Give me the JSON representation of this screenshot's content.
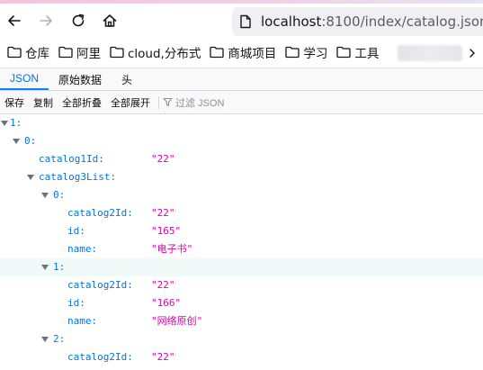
{
  "browser": {
    "url_host": "localhost",
    "url_rest": ":8100/index/catalog.json",
    "bookmarks": [
      {
        "label": "仓库"
      },
      {
        "label": "阿里"
      },
      {
        "label": "cloud,分布式"
      },
      {
        "label": "商城项目"
      },
      {
        "label": "学习"
      },
      {
        "label": "工具"
      }
    ]
  },
  "viewer": {
    "tabs": [
      "JSON",
      "原始数据",
      "头"
    ],
    "toolbar": {
      "save": "保存",
      "copy": "复制",
      "collapse_all": "全部折叠",
      "expand_all": "全部展开",
      "filter_placeholder": "过滤 JSON"
    }
  },
  "tree": [
    {
      "key": "1:",
      "value": null
    },
    {
      "key": "0:",
      "value": null
    },
    {
      "key": "catalog1Id:",
      "value": "\"22\""
    },
    {
      "key": "catalog3List:",
      "value": null
    },
    {
      "key": "0:",
      "value": null
    },
    {
      "key": "catalog2Id:",
      "value": "\"22\""
    },
    {
      "key": "id:",
      "value": "\"165\""
    },
    {
      "key": "name:",
      "value": "\"电子书\""
    },
    {
      "key": "1:",
      "value": null
    },
    {
      "key": "catalog2Id:",
      "value": "\"22\""
    },
    {
      "key": "id:",
      "value": "\"166\""
    },
    {
      "key": "name:",
      "value": "\"网络原创\""
    },
    {
      "key": "2:",
      "value": null
    },
    {
      "key": "catalog2Id:",
      "value": "\"22\""
    }
  ],
  "colors": {
    "key": "#0074e8",
    "string": "#dd00a9",
    "tab_active": "#0a84ff"
  }
}
